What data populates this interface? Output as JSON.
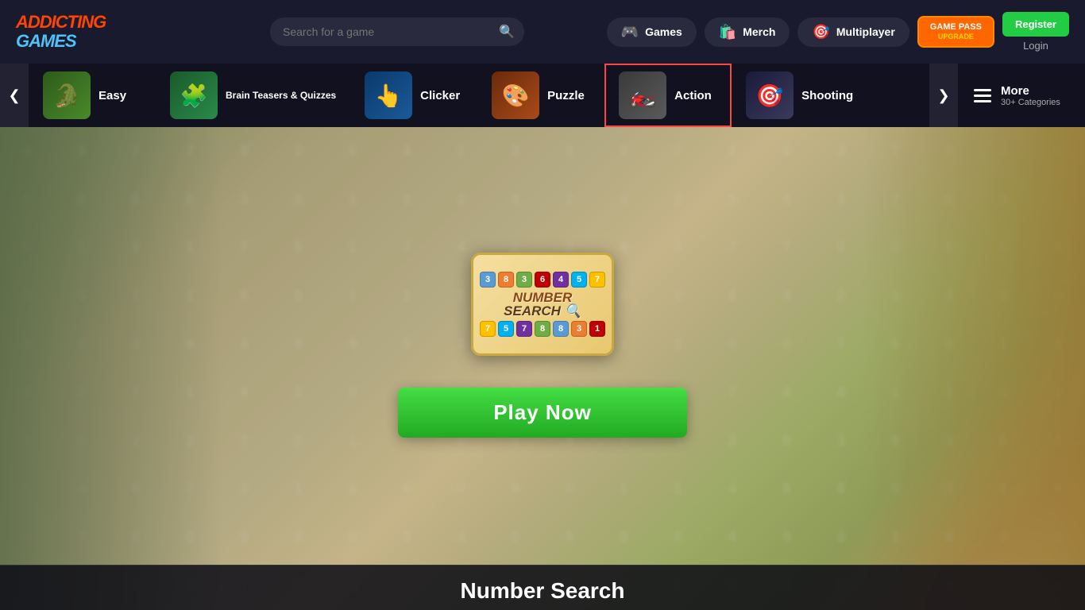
{
  "header": {
    "logo_text": "ADDICTING",
    "logo_text2": "GAMES",
    "search_placeholder": "Search for a game",
    "nav": {
      "games_label": "Games",
      "merch_label": "Merch",
      "multiplayer_label": "Multiplayer",
      "game_pass_label": "GAME PASS",
      "upgrade_label": "UPGRADE",
      "register_label": "Register",
      "login_label": "Login"
    }
  },
  "categories": {
    "prev_arrow": "❮",
    "next_arrow": "❯",
    "items": [
      {
        "id": "easy",
        "label": "Easy",
        "emoji": "🐊"
      },
      {
        "id": "brain",
        "label": "Brain Teasers & Quizzes",
        "emoji": "🧩"
      },
      {
        "id": "clicker",
        "label": "Clicker",
        "emoji": "👆"
      },
      {
        "id": "puzzle",
        "label": "Puzzle",
        "emoji": "🎨"
      },
      {
        "id": "action",
        "label": "Action",
        "emoji": "🏍️"
      },
      {
        "id": "shooting",
        "label": "Shooting",
        "emoji": "🎯"
      }
    ],
    "more_label": "More",
    "more_sub": "30+ Categories"
  },
  "hero": {
    "game_title": "Number Search",
    "play_button": "Play Now",
    "tiles_top": [
      "3",
      "8",
      "3",
      "6",
      "4",
      "5",
      "7"
    ],
    "tiles_bottom": [
      "7",
      "5",
      "7",
      "8",
      "8",
      "3",
      "1"
    ]
  }
}
